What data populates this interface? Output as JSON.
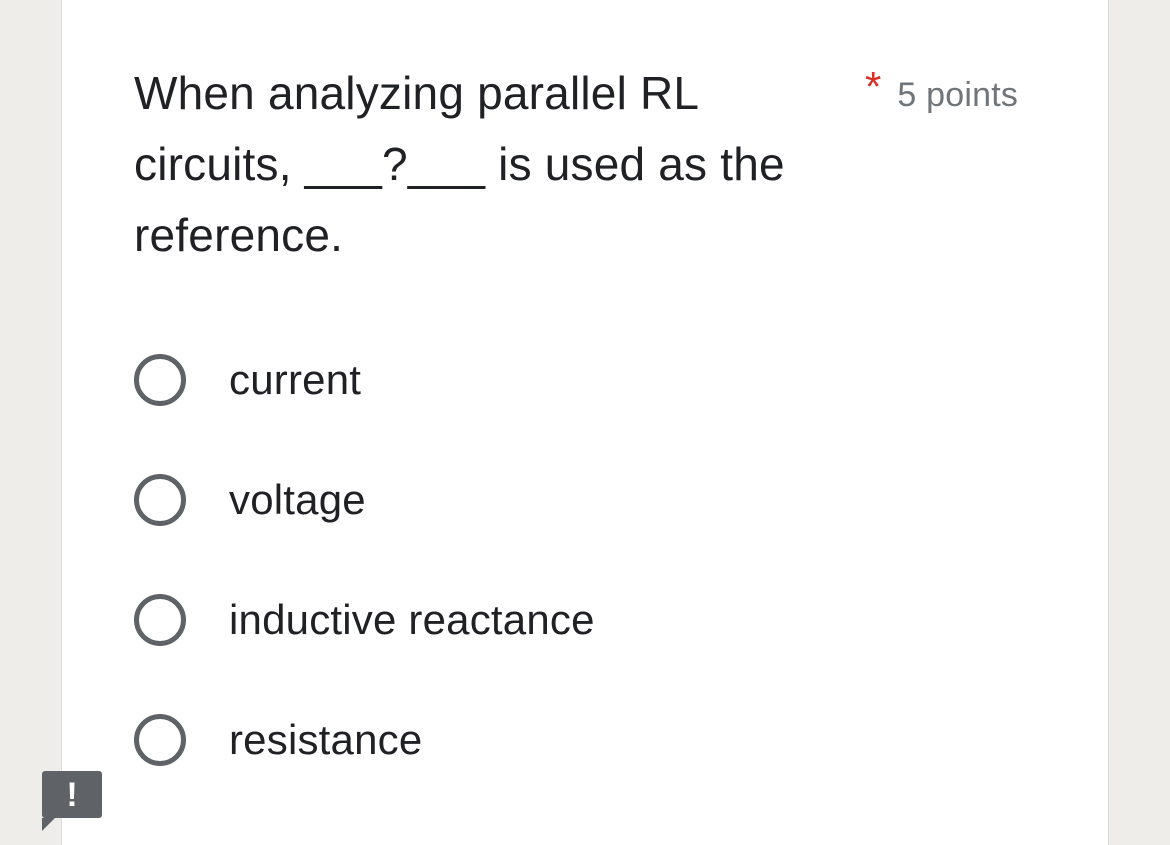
{
  "question": {
    "text": "When analyzing parallel RL circuits, ___?___ is used as the reference.",
    "required_marker": "*",
    "points": "5 points"
  },
  "options": [
    {
      "label": "current"
    },
    {
      "label": "voltage"
    },
    {
      "label": "inductive reactance"
    },
    {
      "label": "resistance"
    }
  ],
  "feedback": {
    "icon": "exclamation-icon",
    "glyph": "!"
  },
  "colors": {
    "required": "#d93025",
    "text": "#202124",
    "muted": "#70757a",
    "radio_border": "#5f6368",
    "page_background": "#eeede9"
  }
}
